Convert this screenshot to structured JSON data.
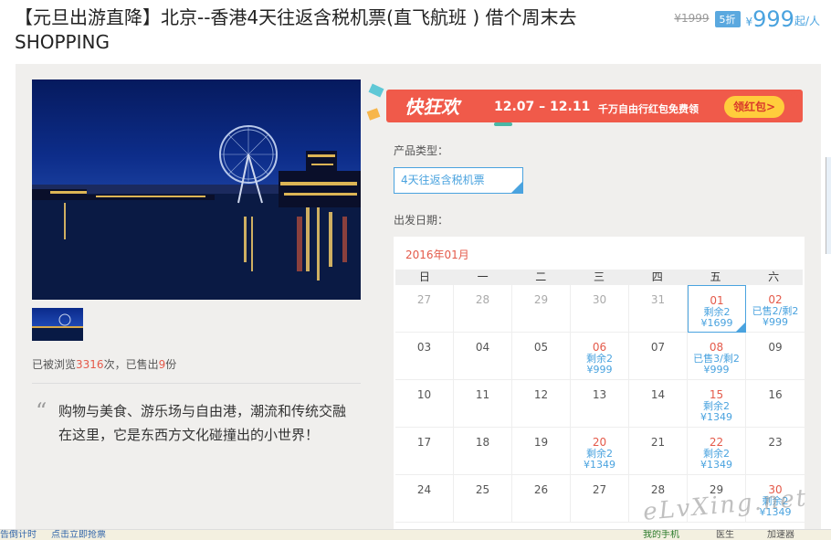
{
  "title": "【元旦出游直降】北京--香港4天往返含税机票(直飞航班 ) 借个周末去SHOPPING",
  "price": {
    "original": "¥1999",
    "discount": "5折",
    "currency": "¥",
    "current": "999",
    "unit": "起/人"
  },
  "stats": {
    "prefix": "已被浏览",
    "views": "3316",
    "mid": "次，已售出",
    "sold": "9",
    "suffix": "份"
  },
  "description": "购物与美食、游乐场与自由港，潮流和传统交融在这里，它是东西方文化碰撞出的小世界！",
  "banner": {
    "logo": "快狂欢",
    "dates": "12.07 – 12.11",
    "text": "千万自由行红包免费领",
    "button": "领红包>"
  },
  "product_type": {
    "label": "产品类型：",
    "value": "4天往返含税机票"
  },
  "date_label": "出发日期：",
  "calendar": {
    "month": "2016年01月",
    "weekdays": [
      "日",
      "一",
      "二",
      "三",
      "四",
      "五",
      "六"
    ],
    "rows": [
      [
        {
          "d": "27"
        },
        {
          "d": "28"
        },
        {
          "d": "29"
        },
        {
          "d": "30"
        },
        {
          "d": "31"
        },
        {
          "d": "01",
          "l1": "剩余2",
          "l2": "¥1699"
        },
        {
          "d": "02",
          "l1": "已售2/剩2",
          "l2": "¥999"
        }
      ],
      [
        {
          "d": "03"
        },
        {
          "d": "04"
        },
        {
          "d": "05"
        },
        {
          "d": "06",
          "l1": "剩余2",
          "l2": "¥999"
        },
        {
          "d": "07"
        },
        {
          "d": "08",
          "l1": "已售3/剩2",
          "l2": "¥999"
        },
        {
          "d": "09"
        }
      ],
      [
        {
          "d": "10"
        },
        {
          "d": "11"
        },
        {
          "d": "12"
        },
        {
          "d": "13"
        },
        {
          "d": "14"
        },
        {
          "d": "15",
          "l1": "剩余2",
          "l2": "¥1349"
        },
        {
          "d": "16"
        }
      ],
      [
        {
          "d": "17"
        },
        {
          "d": "18"
        },
        {
          "d": "19"
        },
        {
          "d": "20",
          "l1": "剩余2",
          "l2": "¥1349"
        },
        {
          "d": "21"
        },
        {
          "d": "22",
          "l1": "剩余2",
          "l2": "¥1349"
        },
        {
          "d": "23"
        }
      ],
      [
        {
          "d": "24"
        },
        {
          "d": "25"
        },
        {
          "d": "26"
        },
        {
          "d": "27"
        },
        {
          "d": "28"
        },
        {
          "d": "29"
        },
        {
          "d": "30",
          "l1": "剩余2",
          "l2": "¥1349"
        }
      ]
    ]
  },
  "watermark": "eLvXing.net",
  "statusbar": {
    "left": "告倒计时",
    "link": "点击立即抢票",
    "phone": "我的手机",
    "doctor": "医生",
    "speed": "加速器"
  }
}
